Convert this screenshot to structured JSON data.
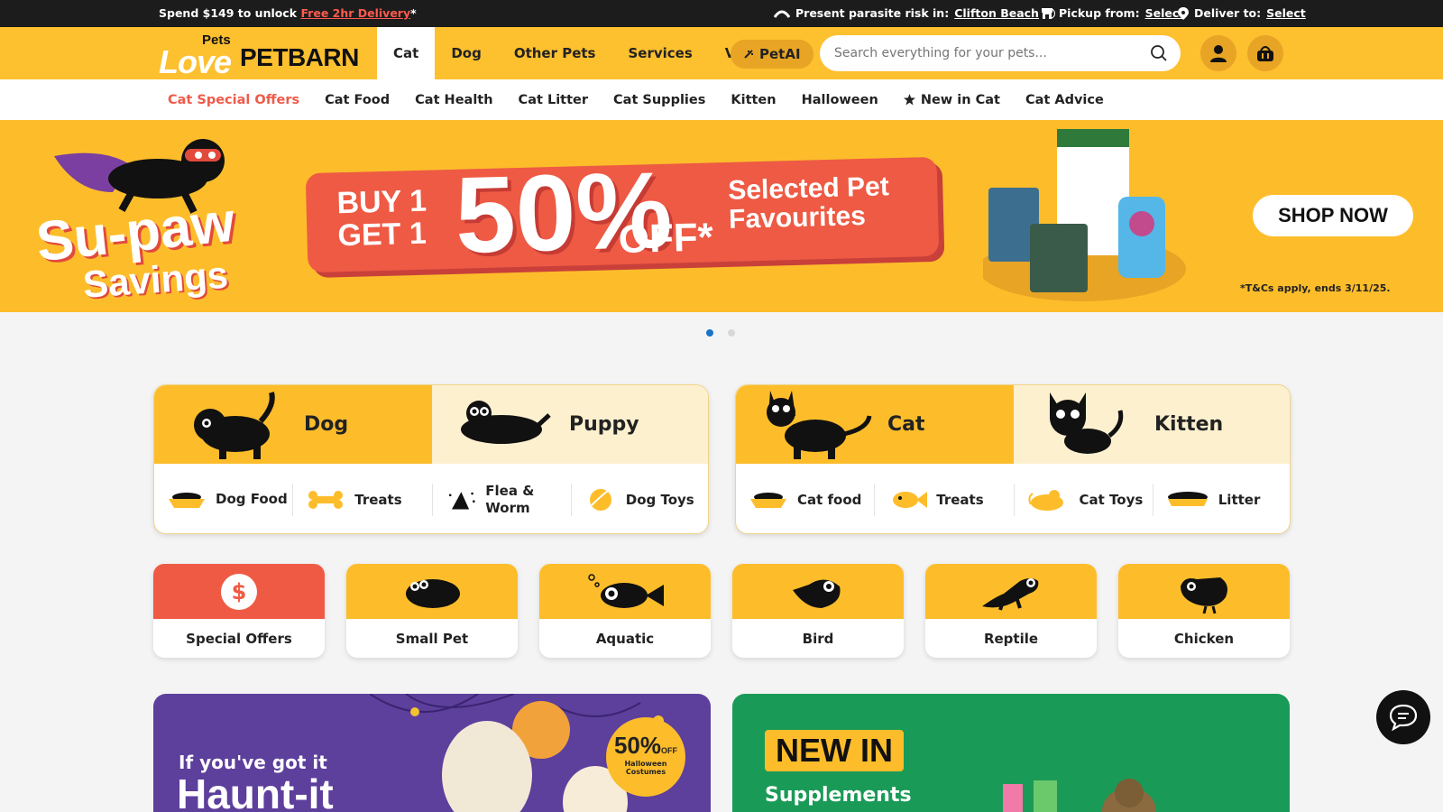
{
  "topbar": {
    "promo_prefix": "Spend $149 to unlock ",
    "promo_link": "Free 2hr Delivery",
    "promo_suffix": "*",
    "parasite_label": "Present parasite risk in:",
    "parasite_location": "Clifton Beach",
    "pickup_label": "Pickup from:",
    "pickup_value": "Select",
    "deliver_label": "Deliver to:",
    "deliver_value": "Select"
  },
  "logo": {
    "small": "Pets",
    "love": "Love",
    "brand": "PETBARN"
  },
  "nav": {
    "items": [
      "Cat",
      "Dog",
      "Other Pets",
      "Services",
      "Vet"
    ],
    "active": "Cat",
    "petai": "PetAI"
  },
  "search": {
    "placeholder": "Search everything for your pets..."
  },
  "subnav": {
    "items": [
      "Cat Special Offers",
      "Cat Food",
      "Cat Health",
      "Cat Litter",
      "Cat Supplies",
      "Kitten",
      "Halloween",
      "New in Cat",
      "Cat Advice"
    ]
  },
  "hero": {
    "su": "Su-paw",
    "savings": "Savings",
    "buy_line1": "BUY 1",
    "buy_line2": "GET 1",
    "percent": "50%",
    "off": "OFF*",
    "selected_line1": "Selected Pet",
    "selected_line2": "Favourites",
    "cta": "SHOP NOW",
    "terms": "*T&Cs apply, ends 3/11/25."
  },
  "carousel": {
    "count": 2,
    "active": 0
  },
  "dog_card": {
    "left": "Dog",
    "right": "Puppy",
    "subs": [
      "Dog Food",
      "Treats",
      "Flea & Worm",
      "Dog Toys"
    ]
  },
  "cat_card": {
    "left": "Cat",
    "right": "Kitten",
    "subs": [
      "Cat food",
      "Treats",
      "Cat Toys",
      "Litter"
    ]
  },
  "tiles": [
    "Special Offers",
    "Small Pet",
    "Aquatic",
    "Bird",
    "Reptile",
    "Chicken"
  ],
  "banners": {
    "halloween_line1": "If you've got it",
    "halloween_line2": "Haunt-it",
    "badge_pct": "50%",
    "badge_off": "OFF",
    "badge_text": "Halloween Costumes",
    "newin_title": "NEW IN",
    "newin_sub": "Supplements"
  },
  "colors": {
    "brand_yellow": "#fdbd2b",
    "accent_red": "#ef5a44",
    "dark": "#1c1c1c",
    "active_dot": "#1a73c9"
  }
}
